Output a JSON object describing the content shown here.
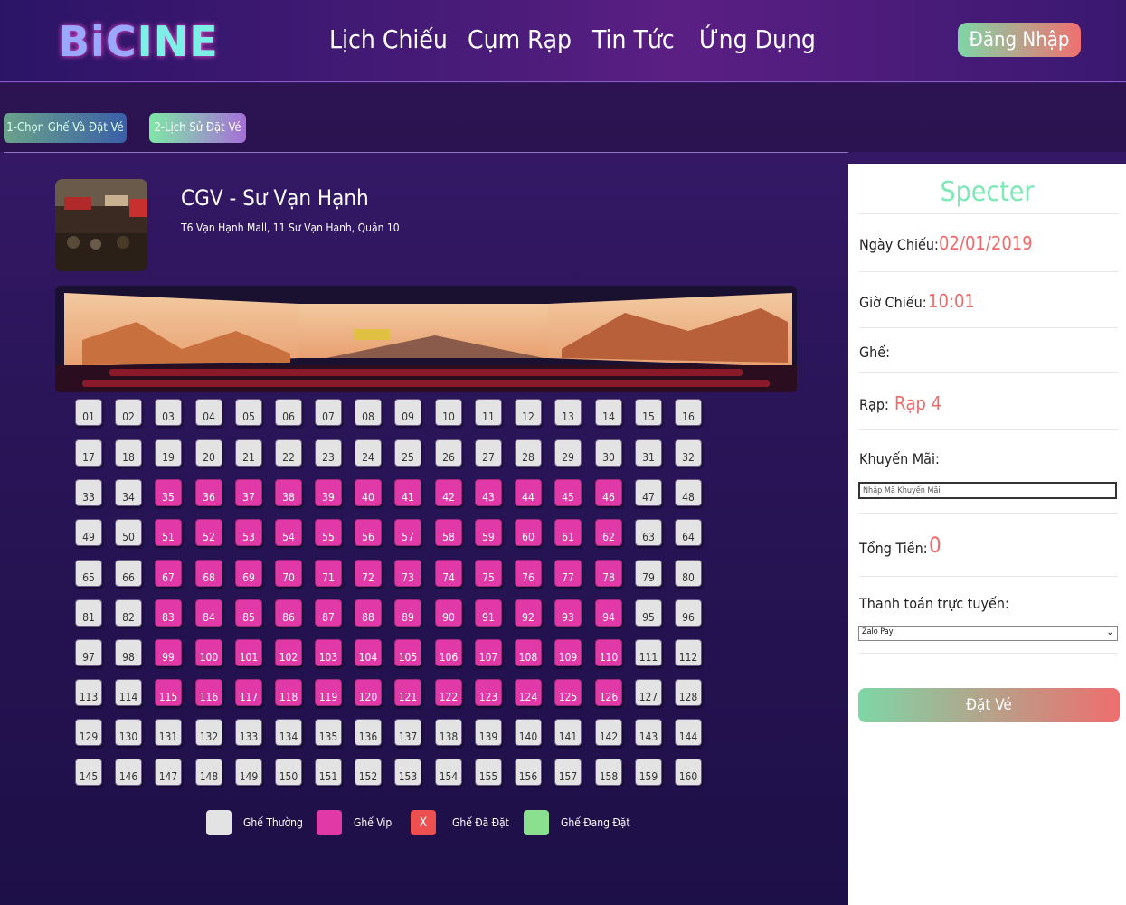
{
  "brand": {
    "logo_part1": "BiC",
    "logo_part2": "INE"
  },
  "nav": {
    "items": [
      "Lịch Chiếu",
      "Cụm Rạp",
      "Tin Tức",
      "Ứng Dụng"
    ],
    "login": "Đăng Nhập"
  },
  "tabs": [
    "1-Chọn Ghế Và Đặt Vé",
    "2-Lịch Sử Đặt Vé"
  ],
  "cinema": {
    "name": "CGV - Sư Vạn Hạnh",
    "address": "T6 Vạn Hạnh Mall, 11 Sư Vạn Hạnh, Quận 10"
  },
  "seats": {
    "columns": 16,
    "rows": 10,
    "labels": [
      "01",
      "02",
      "03",
      "04",
      "05",
      "06",
      "07",
      "08",
      "09",
      "10",
      "11",
      "12",
      "13",
      "14",
      "15",
      "16",
      "17",
      "18",
      "19",
      "20",
      "21",
      "22",
      "23",
      "24",
      "25",
      "26",
      "27",
      "28",
      "29",
      "30",
      "31",
      "32",
      "33",
      "34",
      "35",
      "36",
      "37",
      "38",
      "39",
      "40",
      "41",
      "42",
      "43",
      "44",
      "45",
      "46",
      "47",
      "48",
      "49",
      "50",
      "51",
      "52",
      "53",
      "54",
      "55",
      "56",
      "57",
      "58",
      "59",
      "60",
      "61",
      "62",
      "63",
      "64",
      "65",
      "66",
      "67",
      "68",
      "69",
      "70",
      "71",
      "72",
      "73",
      "74",
      "75",
      "76",
      "77",
      "78",
      "79",
      "80",
      "81",
      "82",
      "83",
      "84",
      "85",
      "86",
      "87",
      "88",
      "89",
      "90",
      "91",
      "92",
      "93",
      "94",
      "95",
      "96",
      "97",
      "98",
      "99",
      "100",
      "101",
      "102",
      "103",
      "104",
      "105",
      "106",
      "107",
      "108",
      "109",
      "110",
      "111",
      "112",
      "113",
      "114",
      "115",
      "116",
      "117",
      "118",
      "119",
      "120",
      "121",
      "122",
      "123",
      "124",
      "125",
      "126",
      "127",
      "128",
      "129",
      "130",
      "131",
      "132",
      "133",
      "134",
      "135",
      "136",
      "137",
      "138",
      "139",
      "140",
      "141",
      "142",
      "143",
      "144",
      "145",
      "146",
      "147",
      "148",
      "149",
      "150",
      "151",
      "152",
      "153",
      "154",
      "155",
      "156",
      "157",
      "158",
      "159",
      "160"
    ],
    "vip_rows": [
      2,
      3,
      4,
      5,
      6,
      7
    ],
    "vip_col_range": [
      2,
      13
    ]
  },
  "legend": [
    {
      "label": "Ghế Thường",
      "color": "#e3e3e3",
      "mark": ""
    },
    {
      "label": "Ghế Vip",
      "color": "#e13aa8",
      "mark": ""
    },
    {
      "label": "Ghế Đã Đặt",
      "color": "#ee4f4f",
      "mark": "X"
    },
    {
      "label": "Ghế Đang Đặt",
      "color": "#8be08f",
      "mark": ""
    }
  ],
  "booking": {
    "movie": "Specter",
    "date_label": "Ngày Chiếu:",
    "date": "02/01/2019",
    "time_label": "Giờ Chiếu:",
    "time": "10:01",
    "seat_label": "Ghế:",
    "room_label": "Rạp:",
    "room": "Rạp 4",
    "promo_label": "Khuyến Mãi:",
    "promo_placeholder": "Nhập Mã Khuyến Mãi",
    "total_label": "Tổng Tiền:",
    "total": "0",
    "payment_label": "Thanh toán trực tuyến:",
    "payment_selected": "Zalo Pay",
    "book_button": "Đặt Vé"
  }
}
